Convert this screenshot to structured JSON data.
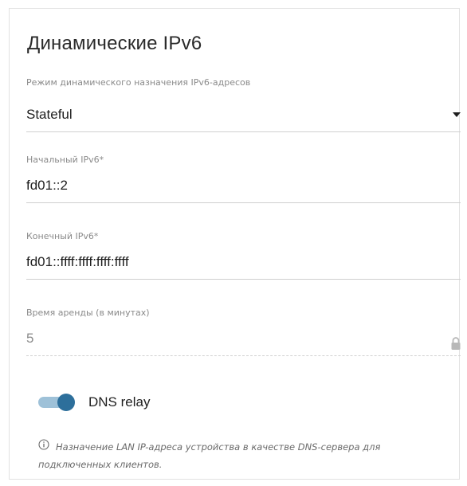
{
  "section": {
    "title": "Динамические IPv6"
  },
  "fields": {
    "mode": {
      "label": "Режим динамического назначения IPv6-адресов",
      "value": "Stateful"
    },
    "start_ip": {
      "label": "Начальный IPv6*",
      "value": "fd01::2"
    },
    "end_ip": {
      "label": "Конечный IPv6*",
      "value": "fd01::ffff:ffff:ffff:ffff"
    },
    "lease_time": {
      "label": "Время аренды (в минутах)",
      "value": "5",
      "disabled": true
    }
  },
  "dns_relay": {
    "label": "DNS relay",
    "enabled": true
  },
  "hint": {
    "text": "Назначение LAN IP-адреса устройства в качестве DNS-сервера для подключенных клиентов."
  },
  "icons": {
    "dropdown": "caret-down-icon",
    "lock": "lock-icon",
    "info": "info-icon"
  },
  "colors": {
    "accent": "#2d6f9b",
    "toggle_track": "#9ec1d8",
    "underline": "#cfcfcf",
    "label": "#8a8a8a"
  }
}
